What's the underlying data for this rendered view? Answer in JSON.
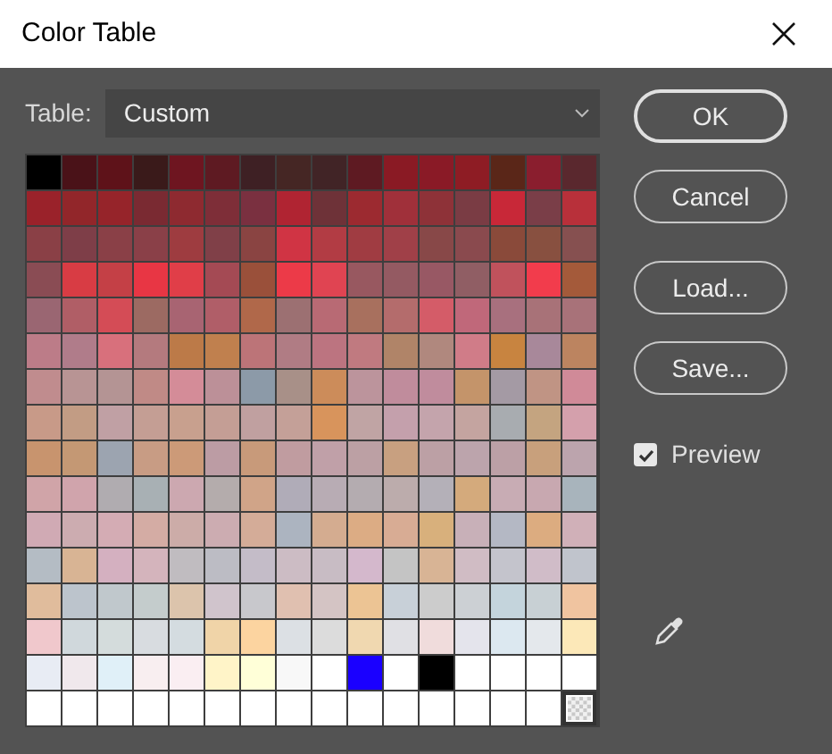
{
  "window": {
    "title": "Color Table"
  },
  "table_select": {
    "label": "Table:",
    "value": "Custom"
  },
  "rows": [
    [
      {
        "kind": "color",
        "color": "#000000"
      },
      {
        "kind": "color",
        "color": "#4a1218"
      },
      {
        "kind": "color",
        "color": "#5e1219"
      },
      {
        "kind": "color",
        "color": "#3a1a1a"
      },
      {
        "kind": "color",
        "color": "#6e1520"
      },
      {
        "kind": "color",
        "color": "#5e1a22"
      },
      {
        "kind": "color",
        "color": "#3e2024"
      },
      {
        "kind": "color",
        "color": "#452624"
      },
      {
        "kind": "color",
        "color": "#412426"
      },
      {
        "kind": "color",
        "color": "#5e1a22"
      },
      {
        "kind": "color",
        "color": "#8a1a24"
      },
      {
        "kind": "color",
        "color": "#8a1a26"
      },
      {
        "kind": "color",
        "color": "#8e1c24"
      },
      {
        "kind": "color",
        "color": "#5a2618"
      },
      {
        "kind": "color",
        "color": "#8a1e2e"
      },
      {
        "kind": "color",
        "color": "#5a282e"
      }
    ],
    [
      {
        "kind": "color",
        "color": "#9a222a"
      },
      {
        "kind": "color",
        "color": "#92262a"
      },
      {
        "kind": "color",
        "color": "#96242a"
      },
      {
        "kind": "color",
        "color": "#7a2a32"
      },
      {
        "kind": "color",
        "color": "#8e2a30"
      },
      {
        "kind": "color",
        "color": "#7e2e38"
      },
      {
        "kind": "color",
        "color": "#7a3040"
      },
      {
        "kind": "color",
        "color": "#b02432"
      },
      {
        "kind": "color",
        "color": "#6e3238"
      },
      {
        "kind": "color",
        "color": "#9c2a30"
      },
      {
        "kind": "color",
        "color": "#a0303a"
      },
      {
        "kind": "color",
        "color": "#8e3238"
      },
      {
        "kind": "color",
        "color": "#7a3c44"
      },
      {
        "kind": "color",
        "color": "#c82838"
      },
      {
        "kind": "color",
        "color": "#7a3e48"
      },
      {
        "kind": "color",
        "color": "#b8303a"
      }
    ],
    [
      {
        "kind": "color",
        "color": "#8a4046"
      },
      {
        "kind": "color",
        "color": "#7e3e48"
      },
      {
        "kind": "color",
        "color": "#8a4047"
      },
      {
        "kind": "color",
        "color": "#8a4048"
      },
      {
        "kind": "color",
        "color": "#9e3c40"
      },
      {
        "kind": "color",
        "color": "#804048"
      },
      {
        "kind": "color",
        "color": "#8a4442"
      },
      {
        "kind": "color",
        "color": "#d03444"
      },
      {
        "kind": "color",
        "color": "#b23c44"
      },
      {
        "kind": "color",
        "color": "#a03c42"
      },
      {
        "kind": "color",
        "color": "#a04048"
      },
      {
        "kind": "color",
        "color": "#884848"
      },
      {
        "kind": "color",
        "color": "#8a4a4e"
      },
      {
        "kind": "color",
        "color": "#8a4a3a"
      },
      {
        "kind": "color",
        "color": "#885040"
      },
      {
        "kind": "color",
        "color": "#865050"
      }
    ],
    [
      {
        "kind": "color",
        "color": "#8a4c54"
      },
      {
        "kind": "color",
        "color": "#d83c44"
      },
      {
        "kind": "color",
        "color": "#c44046"
      },
      {
        "kind": "color",
        "color": "#e83644"
      },
      {
        "kind": "color",
        "color": "#e03e48"
      },
      {
        "kind": "color",
        "color": "#a44a54"
      },
      {
        "kind": "color",
        "color": "#9a503a"
      },
      {
        "kind": "color",
        "color": "#ec3a48"
      },
      {
        "kind": "color",
        "color": "#e04452"
      },
      {
        "kind": "color",
        "color": "#985860"
      },
      {
        "kind": "color",
        "color": "#945a62"
      },
      {
        "kind": "color",
        "color": "#985864"
      },
      {
        "kind": "color",
        "color": "#905e64"
      },
      {
        "kind": "color",
        "color": "#c0525c"
      },
      {
        "kind": "color",
        "color": "#f23c4c"
      },
      {
        "kind": "color",
        "color": "#a45a3a"
      }
    ],
    [
      {
        "kind": "color",
        "color": "#9a6672"
      },
      {
        "kind": "color",
        "color": "#b05e66"
      },
      {
        "kind": "color",
        "color": "#d44c56"
      },
      {
        "kind": "color",
        "color": "#9c6a62"
      },
      {
        "kind": "color",
        "color": "#a86472"
      },
      {
        "kind": "color",
        "color": "#b05e68"
      },
      {
        "kind": "color",
        "color": "#b0684a"
      },
      {
        "kind": "color",
        "color": "#9c7072"
      },
      {
        "kind": "color",
        "color": "#b86a74"
      },
      {
        "kind": "color",
        "color": "#a8705e"
      },
      {
        "kind": "color",
        "color": "#b46c6c"
      },
      {
        "kind": "color",
        "color": "#d45c68"
      },
      {
        "kind": "color",
        "color": "#c0687a"
      },
      {
        "kind": "color",
        "color": "#a8707e"
      },
      {
        "kind": "color",
        "color": "#a87278"
      },
      {
        "kind": "color",
        "color": "#a87279"
      }
    ],
    [
      {
        "kind": "color",
        "color": "#bc7c88"
      },
      {
        "kind": "color",
        "color": "#b07c8a"
      },
      {
        "kind": "color",
        "color": "#d8707c"
      },
      {
        "kind": "color",
        "color": "#b47a7e"
      },
      {
        "kind": "color",
        "color": "#bc7a48"
      },
      {
        "kind": "color",
        "color": "#c0804e"
      },
      {
        "kind": "color",
        "color": "#bc7478"
      },
      {
        "kind": "color",
        "color": "#b07c84"
      },
      {
        "kind": "color",
        "color": "#bc7480"
      },
      {
        "kind": "color",
        "color": "#c07a80"
      },
      {
        "kind": "color",
        "color": "#b08468"
      },
      {
        "kind": "color",
        "color": "#b0887e"
      },
      {
        "kind": "color",
        "color": "#d07c88"
      },
      {
        "kind": "color",
        "color": "#c88440"
      },
      {
        "kind": "color",
        "color": "#a8889a"
      },
      {
        "kind": "color",
        "color": "#bc8460"
      }
    ],
    [
      {
        "kind": "color",
        "color": "#c08c8e"
      },
      {
        "kind": "color",
        "color": "#b89494"
      },
      {
        "kind": "color",
        "color": "#b49494"
      },
      {
        "kind": "color",
        "color": "#c08a86"
      },
      {
        "kind": "color",
        "color": "#d48c98"
      },
      {
        "kind": "color",
        "color": "#bc9098"
      },
      {
        "kind": "color",
        "color": "#8c9aa8"
      },
      {
        "kind": "color",
        "color": "#a89088"
      },
      {
        "kind": "color",
        "color": "#cc8c5a"
      },
      {
        "kind": "color",
        "color": "#bc949c"
      },
      {
        "kind": "color",
        "color": "#c08c9c"
      },
      {
        "kind": "color",
        "color": "#c08c9d"
      },
      {
        "kind": "color",
        "color": "#c4946a"
      },
      {
        "kind": "color",
        "color": "#a49aa4"
      },
      {
        "kind": "color",
        "color": "#c09484"
      },
      {
        "kind": "color",
        "color": "#d08a98"
      }
    ],
    [
      {
        "kind": "color",
        "color": "#c89a88"
      },
      {
        "kind": "color",
        "color": "#c29c84"
      },
      {
        "kind": "color",
        "color": "#c0a0a4"
      },
      {
        "kind": "color",
        "color": "#c49e94"
      },
      {
        "kind": "color",
        "color": "#c8a08e"
      },
      {
        "kind": "color",
        "color": "#c49e95"
      },
      {
        "kind": "color",
        "color": "#c0a0a0"
      },
      {
        "kind": "color",
        "color": "#c4a098"
      },
      {
        "kind": "color",
        "color": "#d8945c"
      },
      {
        "kind": "color",
        "color": "#c0a4a4"
      },
      {
        "kind": "color",
        "color": "#c4a0ac"
      },
      {
        "kind": "color",
        "color": "#c4a4ac"
      },
      {
        "kind": "color",
        "color": "#c4a4a0"
      },
      {
        "kind": "color",
        "color": "#a8acb0"
      },
      {
        "kind": "color",
        "color": "#c4a480"
      },
      {
        "kind": "color",
        "color": "#d4a0ac"
      }
    ],
    [
      {
        "kind": "color",
        "color": "#c8946e"
      },
      {
        "kind": "color",
        "color": "#c49874"
      },
      {
        "kind": "color",
        "color": "#9ca4b0"
      },
      {
        "kind": "color",
        "color": "#c89c84"
      },
      {
        "kind": "color",
        "color": "#cc9a78"
      },
      {
        "kind": "color",
        "color": "#bc9ca4"
      },
      {
        "kind": "color",
        "color": "#c89a7a"
      },
      {
        "kind": "color",
        "color": "#c09ca0"
      },
      {
        "kind": "color",
        "color": "#c0a0a8"
      },
      {
        "kind": "color",
        "color": "#bca0a4"
      },
      {
        "kind": "color",
        "color": "#c8a080"
      },
      {
        "kind": "color",
        "color": "#bca0a5"
      },
      {
        "kind": "color",
        "color": "#bca4ac"
      },
      {
        "kind": "color",
        "color": "#bca0a6"
      },
      {
        "kind": "color",
        "color": "#c8a07c"
      },
      {
        "kind": "color",
        "color": "#bca4ad"
      }
    ],
    [
      {
        "kind": "color",
        "color": "#d0a4a8"
      },
      {
        "kind": "color",
        "color": "#d0a4ac"
      },
      {
        "kind": "color",
        "color": "#b0acb0"
      },
      {
        "kind": "color",
        "color": "#a8b0b4"
      },
      {
        "kind": "color",
        "color": "#cca8b0"
      },
      {
        "kind": "color",
        "color": "#b4acac"
      },
      {
        "kind": "color",
        "color": "#d0a488"
      },
      {
        "kind": "color",
        "color": "#b0acb8"
      },
      {
        "kind": "color",
        "color": "#b8acb4"
      },
      {
        "kind": "color",
        "color": "#b4acb0"
      },
      {
        "kind": "color",
        "color": "#bcacac"
      },
      {
        "kind": "color",
        "color": "#b4b0b8"
      },
      {
        "kind": "color",
        "color": "#d4aa7c"
      },
      {
        "kind": "color",
        "color": "#c8acb4"
      },
      {
        "kind": "color",
        "color": "#c8a8b0"
      },
      {
        "kind": "color",
        "color": "#a8b4bc"
      }
    ],
    [
      {
        "kind": "color",
        "color": "#d0aab4"
      },
      {
        "kind": "color",
        "color": "#ccacb0"
      },
      {
        "kind": "color",
        "color": "#d4acb4"
      },
      {
        "kind": "color",
        "color": "#d4aca4"
      },
      {
        "kind": "color",
        "color": "#ccaca8"
      },
      {
        "kind": "color",
        "color": "#ccacb1"
      },
      {
        "kind": "color",
        "color": "#d4ac98"
      },
      {
        "kind": "color",
        "color": "#acb4c0"
      },
      {
        "kind": "color",
        "color": "#d4ac90"
      },
      {
        "kind": "color",
        "color": "#dcac84"
      },
      {
        "kind": "color",
        "color": "#d8ac94"
      },
      {
        "kind": "color",
        "color": "#d8b07c"
      },
      {
        "kind": "color",
        "color": "#c8b0b8"
      },
      {
        "kind": "color",
        "color": "#b4b8c4"
      },
      {
        "kind": "color",
        "color": "#dcac80"
      },
      {
        "kind": "color",
        "color": "#d0b0b8"
      }
    ],
    [
      {
        "kind": "color",
        "color": "#b4bcc4"
      },
      {
        "kind": "color",
        "color": "#d8b494"
      },
      {
        "kind": "color",
        "color": "#d4b0c0"
      },
      {
        "kind": "color",
        "color": "#d4b4bc"
      },
      {
        "kind": "color",
        "color": "#c0bcc0"
      },
      {
        "kind": "color",
        "color": "#bcbcc4"
      },
      {
        "kind": "color",
        "color": "#c4bcc8"
      },
      {
        "kind": "color",
        "color": "#ccbcc4"
      },
      {
        "kind": "color",
        "color": "#c8bcc4"
      },
      {
        "kind": "color",
        "color": "#d4b8cc"
      },
      {
        "kind": "color",
        "color": "#c4c4c4"
      },
      {
        "kind": "color",
        "color": "#d8b495"
      },
      {
        "kind": "color",
        "color": "#d0bcc4"
      },
      {
        "kind": "color",
        "color": "#c4c4cc"
      },
      {
        "kind": "color",
        "color": "#d0bcc8"
      },
      {
        "kind": "color",
        "color": "#c0c4cc"
      }
    ],
    [
      {
        "kind": "color",
        "color": "#e0bc9c"
      },
      {
        "kind": "color",
        "color": "#bcc4cc"
      },
      {
        "kind": "color",
        "color": "#c0c8cc"
      },
      {
        "kind": "color",
        "color": "#c4cccc"
      },
      {
        "kind": "color",
        "color": "#dcc4ac"
      },
      {
        "kind": "color",
        "color": "#d0c4cc"
      },
      {
        "kind": "color",
        "color": "#c8c8cc"
      },
      {
        "kind": "color",
        "color": "#e0c0b0"
      },
      {
        "kind": "color",
        "color": "#d4c4c4"
      },
      {
        "kind": "color",
        "color": "#ecc494"
      },
      {
        "kind": "color",
        "color": "#c8d0d8"
      },
      {
        "kind": "color",
        "color": "#cccccc"
      },
      {
        "kind": "color",
        "color": "#ccd0d4"
      },
      {
        "kind": "color",
        "color": "#c4d4dc"
      },
      {
        "kind": "color",
        "color": "#c8d0d4"
      },
      {
        "kind": "color",
        "color": "#f0c4a0"
      }
    ],
    [
      {
        "kind": "color",
        "color": "#f0c8cc"
      },
      {
        "kind": "color",
        "color": "#d0d8dc"
      },
      {
        "kind": "color",
        "color": "#d4dcdc"
      },
      {
        "kind": "color",
        "color": "#d8dce0"
      },
      {
        "kind": "color",
        "color": "#d4dce0"
      },
      {
        "kind": "color",
        "color": "#f0d4a8"
      },
      {
        "kind": "color",
        "color": "#fcd4a0"
      },
      {
        "kind": "color",
        "color": "#dce0e4"
      },
      {
        "kind": "color",
        "color": "#dcdcdc"
      },
      {
        "kind": "color",
        "color": "#f0d8b0"
      },
      {
        "kind": "color",
        "color": "#e0e0e4"
      },
      {
        "kind": "color",
        "color": "#f0dcdc"
      },
      {
        "kind": "color",
        "color": "#e4e4ec"
      },
      {
        "kind": "color",
        "color": "#dce8f0"
      },
      {
        "kind": "color",
        "color": "#e4e8ec"
      },
      {
        "kind": "color",
        "color": "#fce8b8"
      }
    ],
    [
      {
        "kind": "color",
        "color": "#e8ecf4"
      },
      {
        "kind": "color",
        "color": "#f0e8ec"
      },
      {
        "kind": "color",
        "color": "#e0f0f8"
      },
      {
        "kind": "color",
        "color": "#f8eef0"
      },
      {
        "kind": "color",
        "color": "#faeef2"
      },
      {
        "kind": "color",
        "color": "#fff4c8"
      },
      {
        "kind": "color",
        "color": "#ffffd8"
      },
      {
        "kind": "color",
        "color": "#f8f8f8"
      },
      {
        "kind": "color",
        "color": "#ffffff"
      },
      {
        "kind": "color",
        "color": "#1a00ff"
      },
      {
        "kind": "color",
        "color": "#ffffff"
      },
      {
        "kind": "color",
        "color": "#000000"
      },
      {
        "kind": "color",
        "color": "#ffffff"
      },
      {
        "kind": "color",
        "color": "#ffffff"
      },
      {
        "kind": "color",
        "color": "#ffffff"
      },
      {
        "kind": "color",
        "color": "#ffffff"
      }
    ],
    [
      {
        "kind": "color",
        "color": "#ffffff"
      },
      {
        "kind": "color",
        "color": "#ffffff"
      },
      {
        "kind": "color",
        "color": "#ffffff"
      },
      {
        "kind": "color",
        "color": "#ffffff"
      },
      {
        "kind": "color",
        "color": "#ffffff"
      },
      {
        "kind": "color",
        "color": "#ffffff"
      },
      {
        "kind": "color",
        "color": "#ffffff"
      },
      {
        "kind": "color",
        "color": "#ffffff"
      },
      {
        "kind": "color",
        "color": "#ffffff"
      },
      {
        "kind": "color",
        "color": "#ffffff"
      },
      {
        "kind": "color",
        "color": "#ffffff"
      },
      {
        "kind": "color",
        "color": "#ffffff"
      },
      {
        "kind": "color",
        "color": "#ffffff"
      },
      {
        "kind": "color",
        "color": "#ffffff"
      },
      {
        "kind": "color",
        "color": "#ffffff"
      },
      {
        "kind": "transparent"
      }
    ]
  ],
  "buttons": [
    {
      "label": "OK",
      "default": true
    },
    {
      "label": "Cancel",
      "default": false
    },
    {
      "label": "Load...",
      "default": false
    },
    {
      "label": "Save...",
      "default": false
    }
  ],
  "preview": {
    "label": "Preview",
    "checked": true
  }
}
